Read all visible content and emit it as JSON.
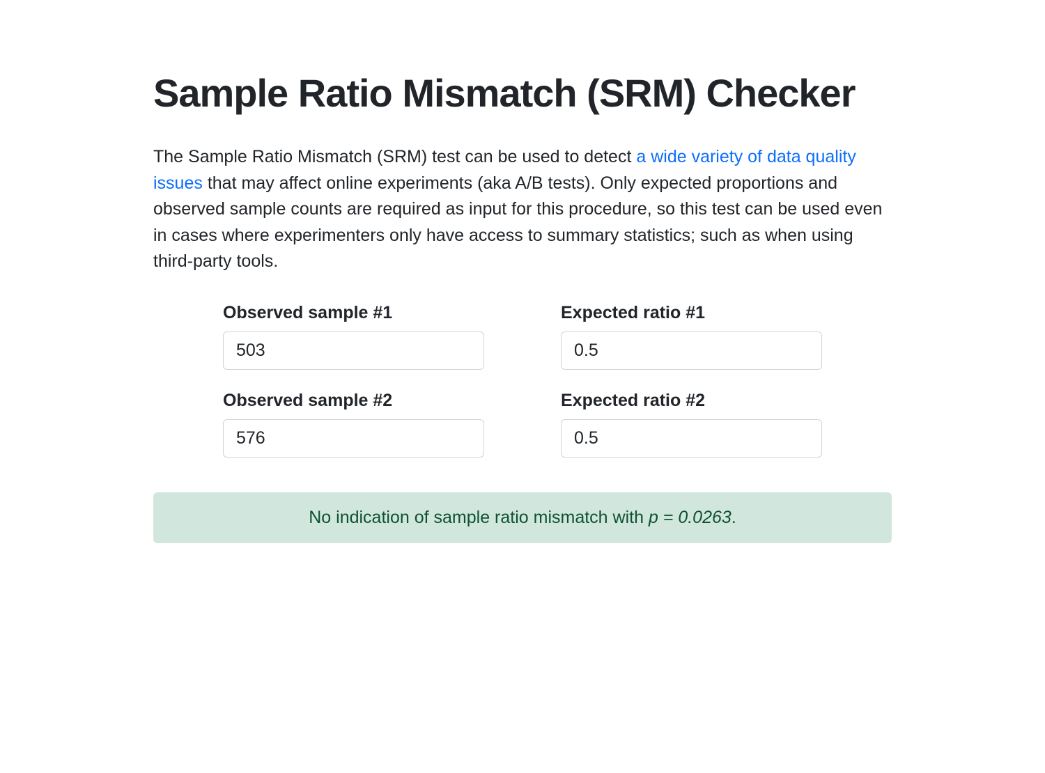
{
  "title": "Sample Ratio Mismatch (SRM) Checker",
  "intro": {
    "before_link": "The Sample Ratio Mismatch (SRM) test can be used to detect ",
    "link_text": "a wide variety of data quality issues",
    "after_link": " that may affect online experiments (aka A/B tests). Only expected proportions and observed sample counts are required as input for this procedure, so this test can be used even in cases where experimenters only have access to summary statistics; such as when using third-party tools."
  },
  "form": {
    "observed1": {
      "label": "Observed sample #1",
      "value": "503"
    },
    "ratio1": {
      "label": "Expected ratio #1",
      "value": "0.5"
    },
    "observed2": {
      "label": "Observed sample #2",
      "value": "576"
    },
    "ratio2": {
      "label": "Expected ratio #2",
      "value": "0.5"
    }
  },
  "result": {
    "prefix": "No indication of sample ratio mismatch with ",
    "pvalue_label": "p = 0.0263",
    "suffix": "."
  }
}
